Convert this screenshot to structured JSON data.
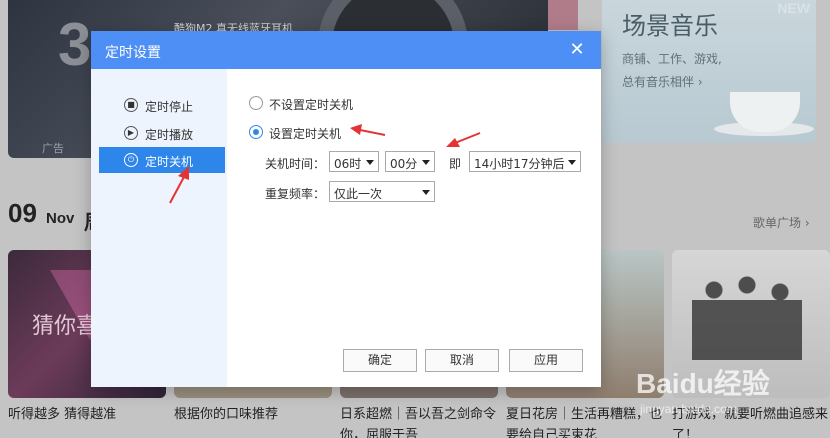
{
  "background": {
    "ad": {
      "big_text": "3",
      "product_tag": "酷狗M2 真无线蓝牙耳机",
      "ad_label": "广告"
    },
    "scene": {
      "title": "场景音乐",
      "subtitle": "商铺、工作、游戏,\n总有音乐相伴 ›",
      "badge": "NEW"
    },
    "date": {
      "day": "09",
      "month": "Nov",
      "heading_fragment": "周"
    },
    "playlist_link": "歌单广场 ›",
    "tile1_text": "猜你喜",
    "captions": [
      "听得越多 猜得越准",
      "根据你的口味推荐",
      "日系超燃｜吾以吾之剑命令你，屈服于吾",
      "夏日花房｜生活再糟糕，也要给自己买束花",
      "打游戏，就要听燃曲追感来了！"
    ],
    "watermark": "Baidu经验",
    "watermark_sub": "jingyan.baidu.com"
  },
  "dialog": {
    "title": "定时设置",
    "close_glyph": "✕",
    "sidebar": [
      {
        "label": "定时停止",
        "icon": "clock-stop-icon",
        "active": false
      },
      {
        "label": "定时播放",
        "icon": "clock-play-icon",
        "active": false
      },
      {
        "label": "定时关机",
        "icon": "power-icon",
        "active": true
      }
    ],
    "options": {
      "no_shutdown": "不设置定时关机",
      "set_shutdown": "设置定时关机",
      "selected": "set_shutdown"
    },
    "shutdown_time": {
      "label": "关机时间：",
      "hour": "06时",
      "minute": "00分",
      "ji": "即",
      "after": "14小时17分钟后"
    },
    "repeat": {
      "label": "重复频率：",
      "value": "仅此一次"
    },
    "buttons": {
      "ok": "确定",
      "cancel": "取消",
      "apply": "应用"
    },
    "accent_color": "#2f86ea",
    "titlebar_color": "#4d8ff4"
  },
  "annotations": {
    "arrow_color": "#e53333"
  }
}
